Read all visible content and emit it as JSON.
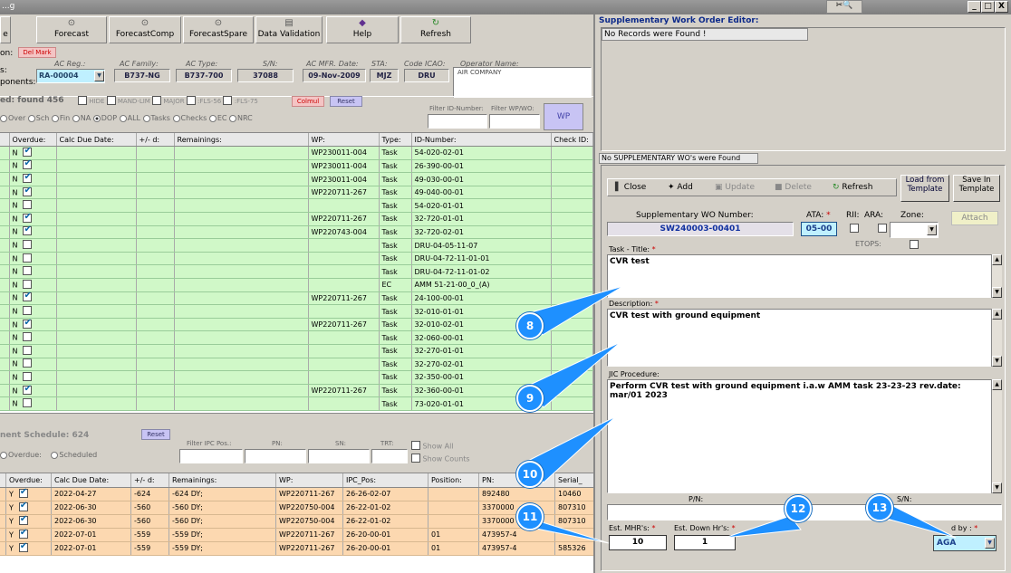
{
  "window": {
    "title": "...g",
    "buttons": [
      "_",
      "□",
      "X"
    ]
  },
  "toolbar": {
    "items": [
      "Forecast",
      "ForecastComp",
      "ForecastSpare",
      "Data Validation",
      "Help",
      "Refresh"
    ]
  },
  "header": {
    "action_label": "on:",
    "del_mark": "Del Mark",
    "components_label": "ponents:",
    "s_label": "s:",
    "fields": [
      {
        "label": "AC Reg.:",
        "value": "RA-00004"
      },
      {
        "label": "AC Family:",
        "value": "B737-NG"
      },
      {
        "label": "AC Type:",
        "value": "B737-700"
      },
      {
        "label": "S/N:",
        "value": "37088"
      },
      {
        "label": "AC MFR. Date:",
        "value": "09-Nov-2009"
      },
      {
        "label": "STA:",
        "value": "MJZ"
      },
      {
        "label": "Code ICAO:",
        "value": "DRU"
      },
      {
        "label": "Operator Name:",
        "value": "AIR COMPANY"
      }
    ]
  },
  "tasks": {
    "found_label": "ed: found",
    "found_count": "456",
    "filters": [
      "HIDE",
      "MAND-LIM",
      "MAJOR",
      "FLS-56",
      "FLS-75"
    ],
    "colmul": "Colmul",
    "reset": "Reset",
    "radios": [
      "Over",
      "Sch",
      "Fin",
      "NA",
      "DOP",
      "ALL",
      "Tasks",
      "Checks",
      "EC",
      "NRC"
    ],
    "filter_id_label": "Filter ID-Number:",
    "filter_wp_label": "Filter WP/WO:",
    "wp_button": "WP",
    "columns": [
      "Overdue:",
      "Calc Due Date:",
      "+/- d:",
      "Remainings:",
      "WP:",
      "Type:",
      "ID-Number:",
      "Check ID:"
    ],
    "rows": [
      {
        "n": "N",
        "chk": true,
        "wp": "WP230011-004",
        "type": "Task",
        "id": "54-020-02-01"
      },
      {
        "n": "N",
        "chk": true,
        "wp": "WP230011-004",
        "type": "Task",
        "id": "26-390-00-01"
      },
      {
        "n": "N",
        "chk": true,
        "wp": "WP230011-004",
        "type": "Task",
        "id": "49-030-00-01"
      },
      {
        "n": "N",
        "chk": true,
        "wp": "WP220711-267",
        "type": "Task",
        "id": "49-040-00-01"
      },
      {
        "n": "N",
        "chk": false,
        "wp": "",
        "type": "Task",
        "id": "54-020-01-01"
      },
      {
        "n": "N",
        "chk": true,
        "wp": "WP220711-267",
        "type": "Task",
        "id": "32-720-01-01"
      },
      {
        "n": "N",
        "chk": true,
        "wp": "WP220743-004",
        "type": "Task",
        "id": "32-720-02-01"
      },
      {
        "n": "N",
        "chk": false,
        "wp": "",
        "type": "Task",
        "id": "DRU-04-05-11-07"
      },
      {
        "n": "N",
        "chk": false,
        "wp": "",
        "type": "Task",
        "id": "DRU-04-72-11-01-01"
      },
      {
        "n": "N",
        "chk": false,
        "wp": "",
        "type": "Task",
        "id": "DRU-04-72-11-01-02"
      },
      {
        "n": "N",
        "chk": false,
        "wp": "",
        "type": "EC",
        "id": "AMM 51-21-00_0_(A)"
      },
      {
        "n": "N",
        "chk": true,
        "wp": "WP220711-267",
        "type": "Task",
        "id": "24-100-00-01"
      },
      {
        "n": "N",
        "chk": false,
        "wp": "",
        "type": "Task",
        "id": "32-010-01-01"
      },
      {
        "n": "N",
        "chk": true,
        "wp": "WP220711-267",
        "type": "Task",
        "id": "32-010-02-01"
      },
      {
        "n": "N",
        "chk": false,
        "wp": "",
        "type": "Task",
        "id": "32-060-00-01"
      },
      {
        "n": "N",
        "chk": false,
        "wp": "",
        "type": "Task",
        "id": "32-270-01-01"
      },
      {
        "n": "N",
        "chk": false,
        "wp": "",
        "type": "Task",
        "id": "32-270-02-01"
      },
      {
        "n": "N",
        "chk": false,
        "wp": "",
        "type": "Task",
        "id": "32-350-00-01"
      },
      {
        "n": "N",
        "chk": true,
        "wp": "WP220711-267",
        "type": "Task",
        "id": "32-360-00-01"
      },
      {
        "n": "N",
        "chk": false,
        "wp": "",
        "type": "Task",
        "id": "73-020-01-01"
      }
    ]
  },
  "components": {
    "title": "nent Schedule: 624",
    "reset": "Reset",
    "radios": [
      "Overdue:",
      "Scheduled"
    ],
    "filters": [
      "Filter IPC Pos.:",
      "PN:",
      "SN:",
      "TRT:"
    ],
    "show_all": "Show All",
    "show_counts": "Show Counts",
    "columns": [
      "Overdue:",
      "Calc Due Date:",
      "+/- d:",
      "Remainings:",
      "WP:",
      "IPC_Pos:",
      "Position:",
      "PN:",
      "Serial_"
    ],
    "rows": [
      {
        "y": "Y",
        "date": "2022-04-27",
        "d": "-624",
        "rem": "-624 DY;",
        "wp": "WP220711-267",
        "ipc": "26-26-02-07",
        "pos": "",
        "pn": "892480",
        "sn": "10460"
      },
      {
        "y": "Y",
        "date": "2022-06-30",
        "d": "-560",
        "rem": "-560 DY;",
        "wp": "WP220750-004",
        "ipc": "26-22-01-02",
        "pos": "",
        "pn": "3370000",
        "sn": "807310"
      },
      {
        "y": "Y",
        "date": "2022-06-30",
        "d": "-560",
        "rem": "-560 DY;",
        "wp": "WP220750-004",
        "ipc": "26-22-01-02",
        "pos": "",
        "pn": "3370000",
        "sn": "807310"
      },
      {
        "y": "Y",
        "date": "2022-07-01",
        "d": "-559",
        "rem": "-559 DY;",
        "wp": "WP220711-267",
        "ipc": "26-20-00-01",
        "pos": "01",
        "pn": "473957-4",
        "sn": ""
      },
      {
        "y": "Y",
        "date": "2022-07-01",
        "d": "-559",
        "rem": "-559 DY;",
        "wp": "WP220711-267",
        "ipc": "26-20-00-01",
        "pos": "01",
        "pn": "473957-4",
        "sn": "585326"
      }
    ]
  },
  "editor": {
    "title": "Supplementary Work Order Editor:",
    "no_records": "No Records were Found !",
    "no_supp": "No SUPPLEMENTARY WO's were Found",
    "buttons": {
      "close": "Close",
      "add": "Add",
      "update": "Update",
      "delete": "Delete",
      "refresh": "Refresh",
      "load": "Load from Template",
      "save": "Save In Template",
      "attach": "Attach"
    },
    "wo_number_label": "Supplementary WO Number:",
    "wo_number": "SW240003-00401",
    "ata_label": "ATA:",
    "ata": "05-00",
    "rii_label": "RII:",
    "ara_label": "ARA:",
    "zone_label": "Zone:",
    "etops_label": "ETOPS:",
    "task_title_label": "Task - Title:",
    "task_title": "CVR test",
    "description_label": "Description:",
    "description": "CVR test with ground equipment",
    "jic_label": "JIC Procedure:",
    "jic": "Perform CVR test with ground equipment i.a.w AMM task 23-23-23 rev.date: mar/01 2023",
    "pn_label": "P/N:",
    "sn_label": "S/N:",
    "mhr_label": "Est. MHR's:",
    "mhr": "10",
    "down_label": "Est. Down Hr's:",
    "down": "1",
    "by_label": "d by :",
    "by": "AGA",
    "req_mark": "*"
  },
  "callouts": [
    "8",
    "9",
    "10",
    "11",
    "12",
    "13"
  ]
}
